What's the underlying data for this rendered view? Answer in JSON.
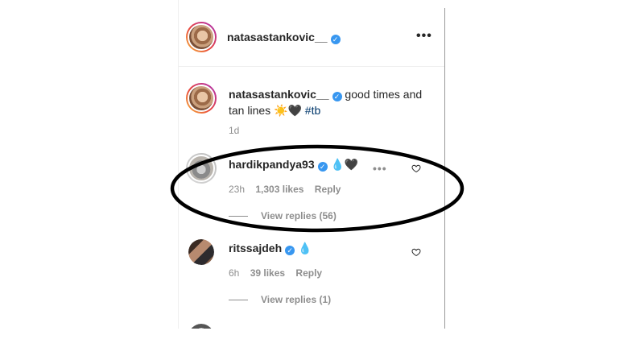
{
  "post_header": {
    "username": "natasastankovic__",
    "more_icon": "more-horizontal-icon"
  },
  "caption": {
    "username": "natasastankovic__",
    "text": " good times and tan lines ☀️🖤",
    "hashtag": "#tb",
    "time": "1d"
  },
  "comments": [
    {
      "username": "hardikpandya93",
      "text": "💧🖤",
      "time": "23h",
      "likes": "1,303 likes",
      "reply": "Reply",
      "view_replies": "View replies (56)",
      "highlighted": true
    },
    {
      "username": "ritssajdeh",
      "text": "💧",
      "time": "6h",
      "likes": "39 likes",
      "reply": "Reply",
      "view_replies": "View replies (1)"
    }
  ],
  "colors": {
    "verified": "#3897f0",
    "hashtag": "#00376b",
    "secondary_text": "#8e8e8e",
    "annotation": "#000000"
  }
}
